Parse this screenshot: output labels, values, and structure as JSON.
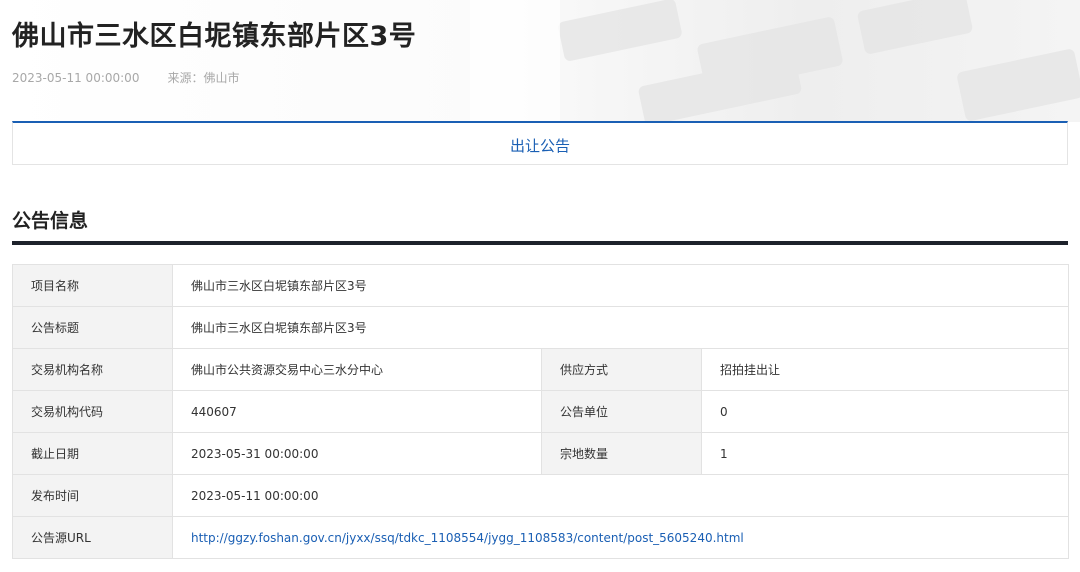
{
  "header": {
    "title": "佛山市三水区白坭镇东部片区3号",
    "date": "2023-05-11 00:00:00",
    "source": "来源：佛山市"
  },
  "tabs": [
    {
      "label": "出让公告",
      "active": true
    }
  ],
  "section": {
    "title": "公告信息"
  },
  "info": {
    "project_name_label": "项目名称",
    "project_name": "佛山市三水区白坭镇东部片区3号",
    "notice_title_label": "公告标题",
    "notice_title": "佛山市三水区白坭镇东部片区3号",
    "agency_name_label": "交易机构名称",
    "agency_name": "佛山市公共资源交易中心三水分中心",
    "supply_method_label": "供应方式",
    "supply_method": "招拍挂出让",
    "agency_code_label": "交易机构代码",
    "agency_code": "440607",
    "notice_unit_label": "公告单位",
    "notice_unit": "0",
    "deadline_label": "截止日期",
    "deadline": "2023-05-31 00:00:00",
    "parcel_count_label": "宗地数量",
    "parcel_count": "1",
    "publish_time_label": "发布时间",
    "publish_time": "2023-05-11 00:00:00",
    "source_url_label": "公告源URL",
    "source_url": "http://ggzy.foshan.gov.cn/jyxx/ssq/tdkc_1108554/jygg_1108583/content/post_5605240.html"
  },
  "colors": {
    "accent": "#1a5fb4",
    "rule": "#1d222b",
    "label_bg": "#f3f3f3",
    "border": "#e2e2e2"
  }
}
